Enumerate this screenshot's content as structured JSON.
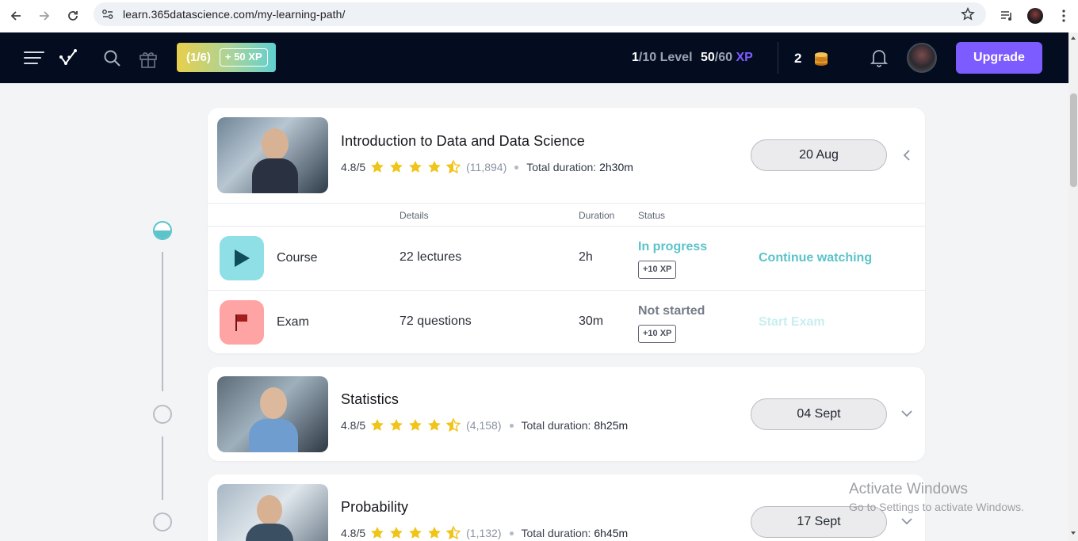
{
  "browser": {
    "url": "learn.365datascience.com/my-learning-path/"
  },
  "header": {
    "quest_count": "(1/6)",
    "quest_xp": "+ 50 XP",
    "level_current": "1",
    "level_rest": "/10 Level",
    "xp_current": "50",
    "xp_rest": "/60 ",
    "xp_unit": "XP",
    "coins": "2",
    "upgrade_label": "Upgrade"
  },
  "table_headers": {
    "details": "Details",
    "duration": "Duration",
    "status": "Status"
  },
  "courses": [
    {
      "title": "Introduction to Data and Data Science",
      "rating": "4.8/5",
      "stars": 4.5,
      "rating_count": "(11,894)",
      "duration_label": "Total duration:",
      "duration": "2h30m",
      "date": "20 Aug",
      "expanded": true,
      "rows": [
        {
          "type": "Course",
          "details": "22 lectures",
          "duration": "2h",
          "status": "In progress",
          "xp": "+10 XP",
          "action": "Continue watching"
        },
        {
          "type": "Exam",
          "details": "72 questions",
          "duration": "30m",
          "status": "Not started",
          "xp": "+10 XP",
          "action": "Start Exam"
        }
      ]
    },
    {
      "title": "Statistics",
      "rating": "4.8/5",
      "stars": 4.5,
      "rating_count": "(4,158)",
      "duration_label": "Total duration:",
      "duration": "8h25m",
      "date": "04 Sept",
      "expanded": false
    },
    {
      "title": "Probability",
      "rating": "4.8/5",
      "stars": 4.5,
      "rating_count": "(1,132)",
      "duration_label": "Total duration:",
      "duration": "6h45m",
      "date": "17 Sept",
      "expanded": false
    }
  ],
  "watermark": {
    "line1": "Activate Windows",
    "line2": "Go to Settings to activate Windows."
  },
  "colors": {
    "header_bg": "#030d1f",
    "accent_purple": "#7c5cff",
    "teal": "#5bc3c9",
    "course_icon_bg": "#8fdfe6",
    "exam_icon_bg": "#ffa4a4"
  }
}
